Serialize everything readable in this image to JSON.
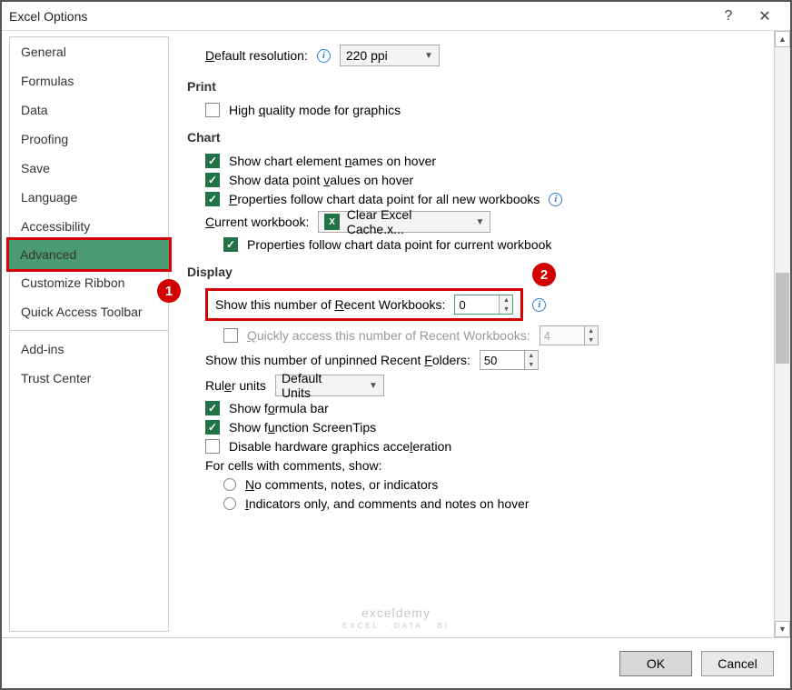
{
  "window": {
    "title": "Excel Options"
  },
  "sidebar": {
    "items": [
      {
        "label": "General"
      },
      {
        "label": "Formulas"
      },
      {
        "label": "Data"
      },
      {
        "label": "Proofing"
      },
      {
        "label": "Save"
      },
      {
        "label": "Language"
      },
      {
        "label": "Accessibility"
      },
      {
        "label": "Advanced"
      },
      {
        "label": "Customize Ribbon"
      },
      {
        "label": "Quick Access Toolbar"
      },
      {
        "label": "Add-ins"
      },
      {
        "label": "Trust Center"
      }
    ],
    "selected_index": 7
  },
  "content": {
    "default_resolution_label": "Default resolution:",
    "default_resolution_value": "220 ppi",
    "print_heading": "Print",
    "high_quality_label": "High quality mode for graphics",
    "chart_heading": "Chart",
    "chart_hover_names": "Show chart element names on hover",
    "chart_hover_values": "Show data point values on hover",
    "chart_props_new": "Properties follow chart data point for all new workbooks",
    "current_workbook_label": "Current workbook:",
    "current_workbook_value": "Clear Excel Cache.x...",
    "chart_props_current": "Properties follow chart data point for current workbook",
    "display_heading": "Display",
    "recent_workbooks_label": "Show this number of Recent Workbooks:",
    "recent_workbooks_value": "0",
    "quick_access_label": "Quickly access this number of Recent Workbooks:",
    "quick_access_value": "4",
    "recent_folders_label": "Show this number of unpinned Recent Folders:",
    "recent_folders_value": "50",
    "ruler_units_label": "Ruler units",
    "ruler_units_value": "Default Units",
    "formula_bar": "Show formula bar",
    "screentips": "Show function ScreenTips",
    "disable_hw": "Disable hardware graphics acceleration",
    "comments_heading": "For cells with comments, show:",
    "comments_none": "No comments, notes, or indicators",
    "comments_ind": "Indicators only, and comments and notes on hover"
  },
  "footer": {
    "ok": "OK",
    "cancel": "Cancel"
  },
  "callouts": {
    "one": "1",
    "two": "2"
  },
  "watermark": {
    "main": "exceldemy",
    "sub": "EXCEL · DATA · BI"
  }
}
